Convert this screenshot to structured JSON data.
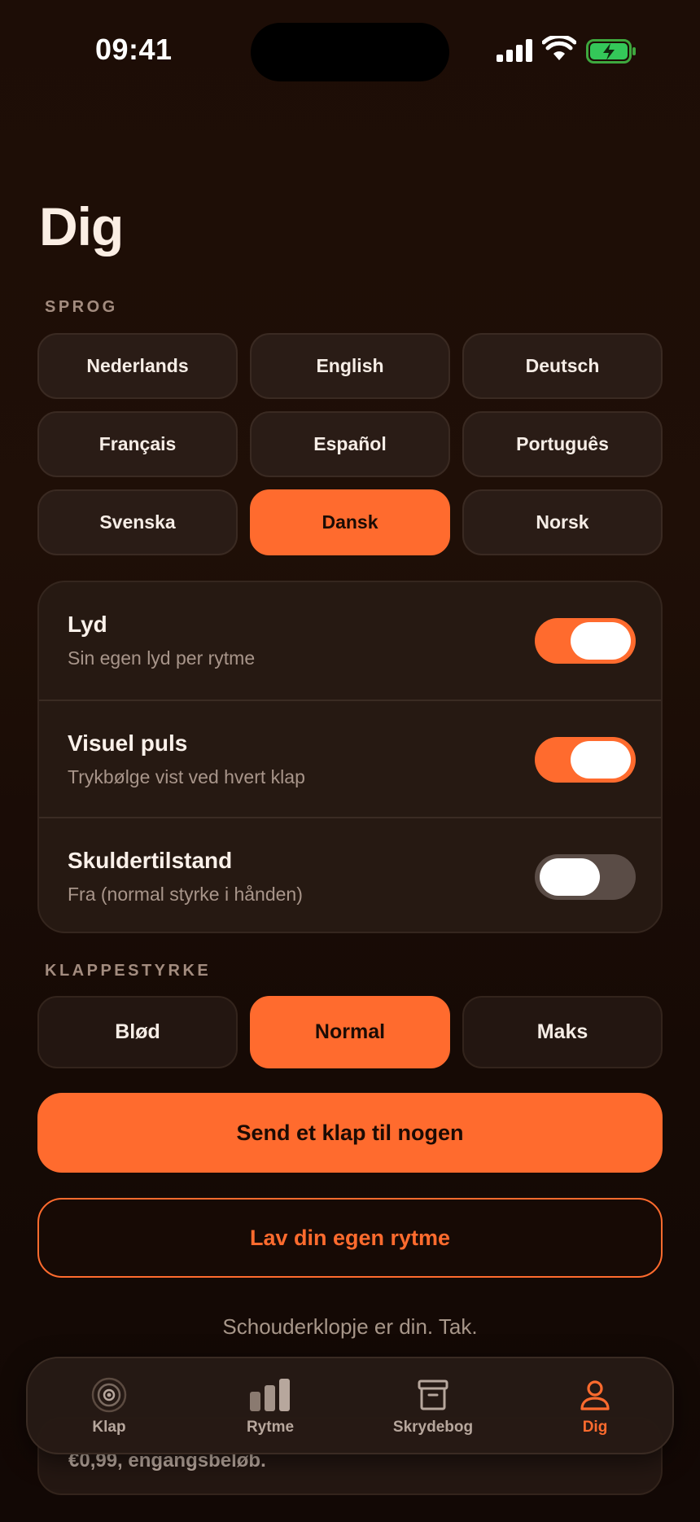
{
  "status_bar": {
    "time": "09:41"
  },
  "title": "Dig",
  "language_section": {
    "label": "SPROG",
    "options": [
      "Nederlands",
      "English",
      "Deutsch",
      "Français",
      "Español",
      "Português",
      "Svenska",
      "Dansk",
      "Norsk"
    ],
    "selected": "Dansk"
  },
  "settings": [
    {
      "title": "Lyd",
      "subtitle": "Sin egen lyd per rytme",
      "enabled": true
    },
    {
      "title": "Visuel puls",
      "subtitle": "Trykbølge vist ved hvert klap",
      "enabled": true
    },
    {
      "title": "Skuldertilstand",
      "subtitle": "Fra (normal styrke i hånden)",
      "enabled": false
    }
  ],
  "strength_section": {
    "label": "KLAPPESTYRKE",
    "options": [
      "Blød",
      "Normal",
      "Maks"
    ],
    "selected": "Normal"
  },
  "actions": {
    "send_label": "Send et klap til nogen",
    "create_label": "Lav din egen rytme"
  },
  "footer_note": "Schouderklopje er din. Tak.",
  "price_note": "€0,99, engangsbeløb.",
  "tab_bar": {
    "items": [
      {
        "label": "Klap",
        "icon": "target-icon"
      },
      {
        "label": "Rytme",
        "icon": "bars-icon"
      },
      {
        "label": "Skrydebog",
        "icon": "archive-box-icon"
      },
      {
        "label": "Dig",
        "icon": "person-icon"
      }
    ],
    "active": "Dig"
  },
  "colors": {
    "accent": "#ff6b2e",
    "background": "#1d0d06",
    "card": "#261912"
  }
}
